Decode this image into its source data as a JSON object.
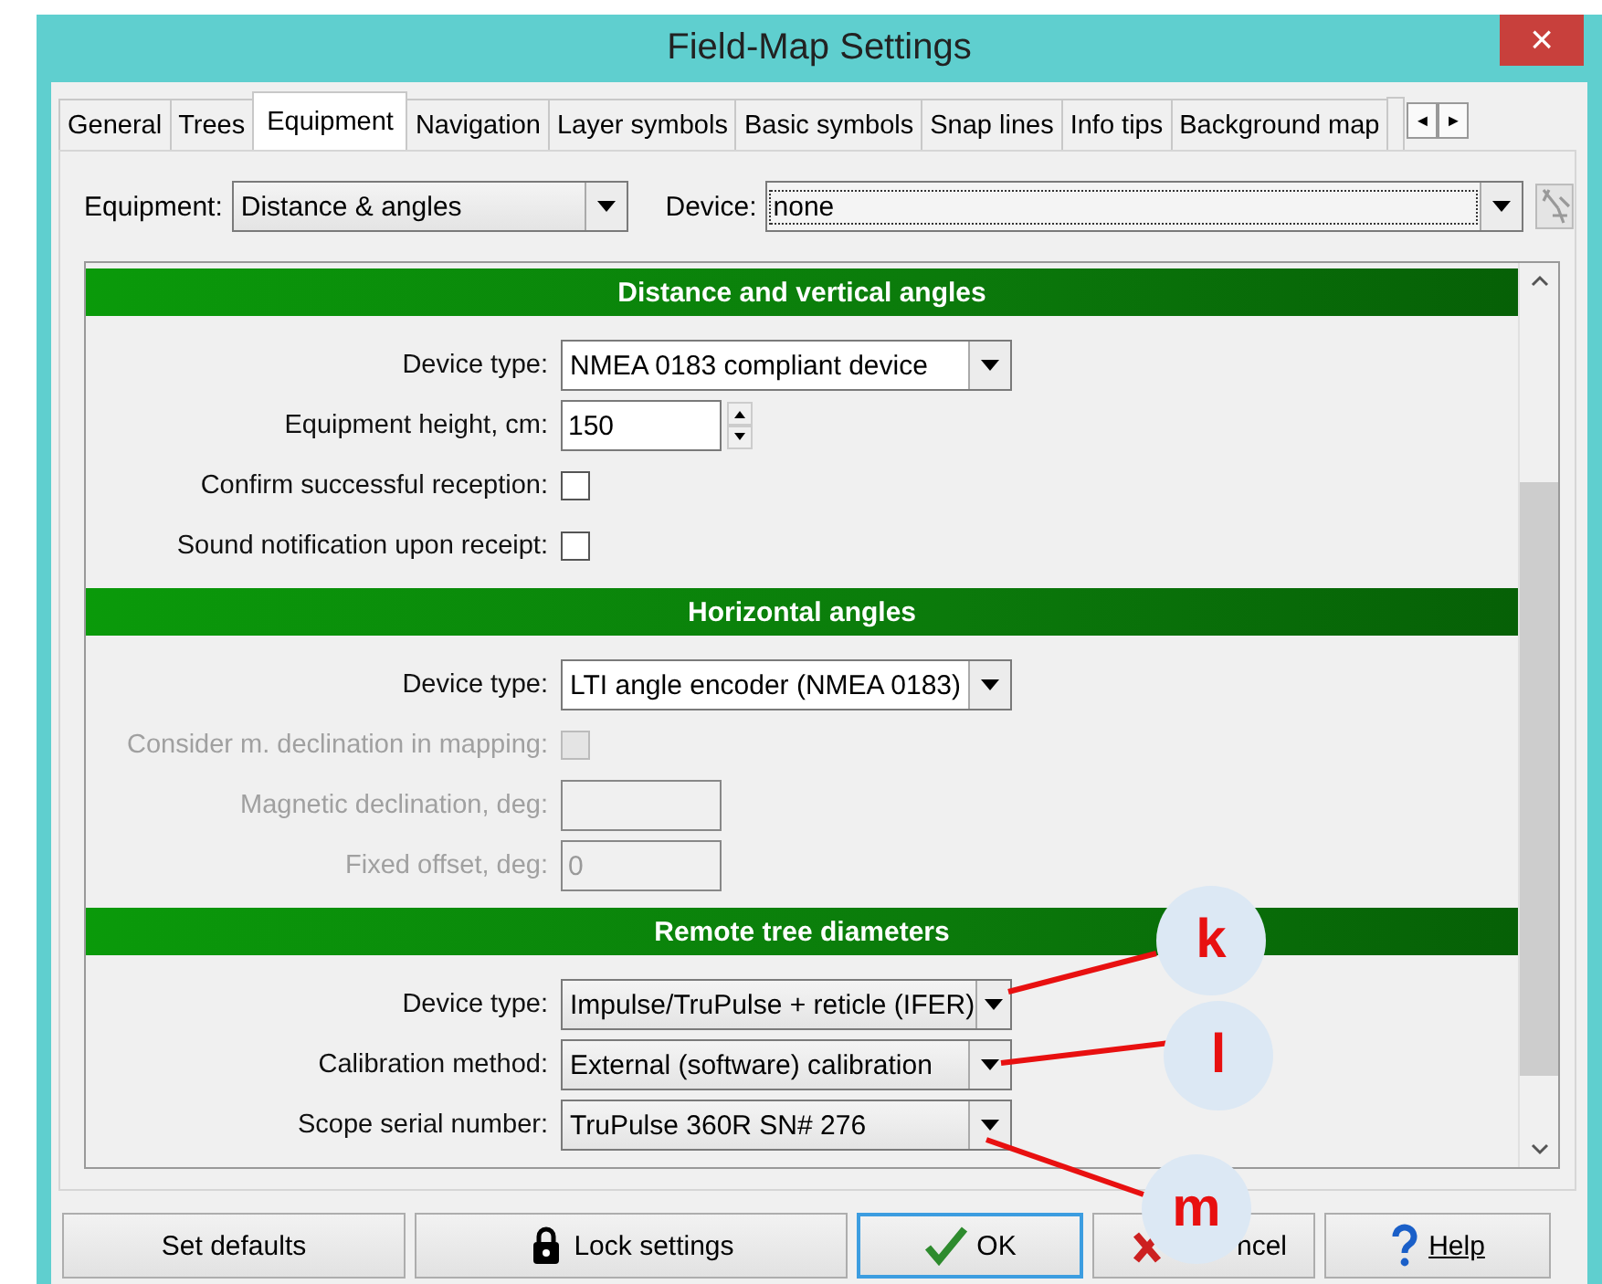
{
  "window": {
    "title": "Field-Map Settings",
    "close": "×"
  },
  "tabs": [
    {
      "label": "General",
      "selected": false
    },
    {
      "label": "Trees",
      "selected": false
    },
    {
      "label": "Equipment",
      "selected": true
    },
    {
      "label": "Navigation",
      "selected": false
    },
    {
      "label": "Layer symbols",
      "selected": false
    },
    {
      "label": "Basic symbols",
      "selected": false
    },
    {
      "label": "Snap lines",
      "selected": false
    },
    {
      "label": "Info tips",
      "selected": false
    },
    {
      "label": "Background map",
      "selected": false
    }
  ],
  "tab_scroll": [
    "◄",
    "►"
  ],
  "equipment": {
    "label": "Equipment:",
    "value": "Distance & angles"
  },
  "device": {
    "label": "Device:",
    "value": "none"
  },
  "sections": [
    {
      "title": "Distance and vertical angles",
      "rows": [
        {
          "kind": "dropdown",
          "label": "Device type:",
          "value": "NMEA 0183 compliant device",
          "disabled": false,
          "white": true
        },
        {
          "kind": "spinner",
          "label": "Equipment height, cm:",
          "value": "150",
          "disabled": false
        },
        {
          "kind": "checkbox",
          "label": "Confirm successful reception:",
          "checked": false,
          "disabled": false
        },
        {
          "kind": "checkbox",
          "label": "Sound notification upon receipt:",
          "checked": false,
          "disabled": false
        }
      ]
    },
    {
      "title": "Horizontal angles",
      "rows": [
        {
          "kind": "dropdown",
          "label": "Device type:",
          "value": "LTI angle encoder (NMEA 0183)",
          "disabled": false,
          "white": true
        },
        {
          "kind": "checkbox",
          "label": "Consider m. declination in mapping:",
          "checked": false,
          "disabled": true
        },
        {
          "kind": "textbox",
          "label": "Magnetic declination, deg:",
          "disabled": true
        },
        {
          "kind": "textbox",
          "label": "Fixed offset, deg:",
          "value": "0",
          "disabled": true
        }
      ]
    },
    {
      "title": "Remote tree diameters",
      "rows": [
        {
          "kind": "dropdown",
          "label": "Device type:",
          "value": "Impulse/TruPulse + reticle (IFER)",
          "disabled": false,
          "white": false
        },
        {
          "kind": "dropdown",
          "label": "Calibration method:",
          "value": "External (software) calibration",
          "disabled": false,
          "white": false
        },
        {
          "kind": "dropdown",
          "label": "Scope serial number:",
          "value": "TruPulse 360R SN# 276",
          "disabled": false,
          "white": false
        }
      ]
    }
  ],
  "buttons": [
    {
      "label": "Set defaults",
      "default": false
    },
    {
      "label": "Lock settings",
      "default": false
    },
    {
      "label": "OK",
      "default": true
    },
    {
      "label": "ncel",
      "default": false
    },
    {
      "label": "Help",
      "default": false
    }
  ],
  "callouts": [
    "k",
    "l",
    "m"
  ]
}
